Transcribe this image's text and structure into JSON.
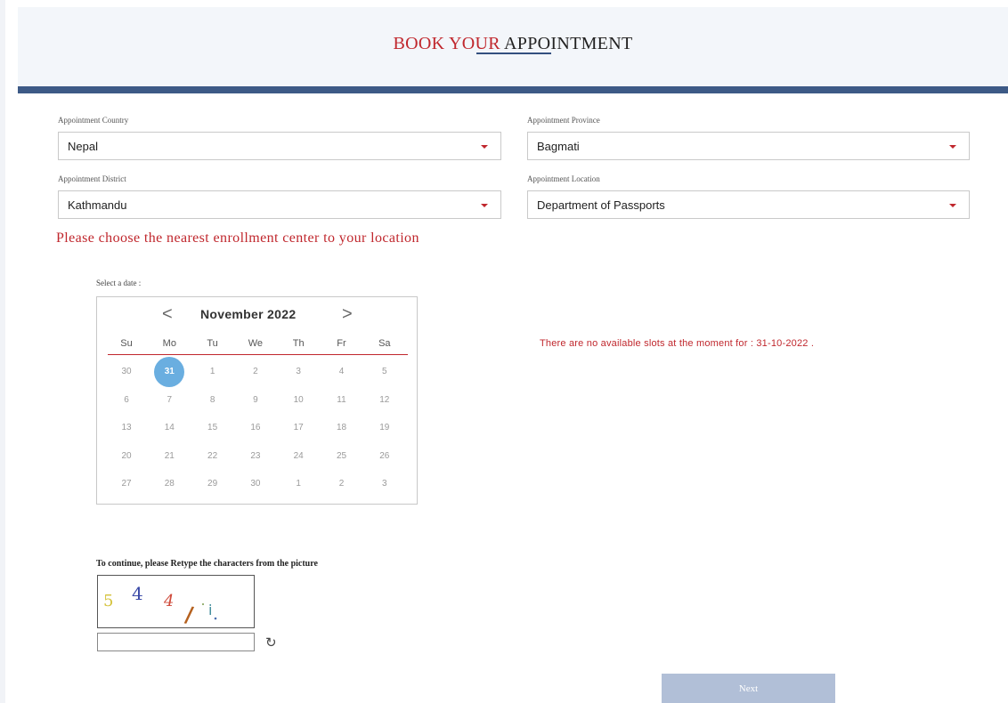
{
  "header": {
    "title_red": "BOOK YOUR",
    "title_dark": "APPOINTMENT"
  },
  "form": {
    "country": {
      "label": "Appointment Country",
      "value": "Nepal"
    },
    "province": {
      "label": "Appointment Province",
      "value": "Bagmati"
    },
    "district": {
      "label": "Appointment District",
      "value": "Kathmandu"
    },
    "location": {
      "label": "Appointment Location",
      "value": "Department of Passports"
    }
  },
  "notice": "Please choose the nearest enrollment center to your location",
  "calendar": {
    "label": "Select a date :",
    "prev": "<",
    "next": ">",
    "month": "November 2022",
    "weekdays": [
      "Su",
      "Mo",
      "Tu",
      "We",
      "Th",
      "Fr",
      "Sa"
    ],
    "weeks": [
      [
        "30",
        "31",
        "1",
        "2",
        "3",
        "4",
        "5"
      ],
      [
        "6",
        "7",
        "8",
        "9",
        "10",
        "11",
        "12"
      ],
      [
        "13",
        "14",
        "15",
        "16",
        "17",
        "18",
        "19"
      ],
      [
        "20",
        "21",
        "22",
        "23",
        "24",
        "25",
        "26"
      ],
      [
        "27",
        "28",
        "29",
        "30",
        "1",
        "2",
        "3"
      ]
    ],
    "selected": "31"
  },
  "slots_message": "There are no available slots at the moment for : 31-10-2022 .",
  "captcha": {
    "label": "To continue, please Retype the characters from the picture",
    "input_value": "",
    "refresh_icon": "refresh-icon",
    "image_chars": [
      "5",
      "4",
      "4",
      "/",
      "i"
    ]
  },
  "next_button": "Next",
  "colors": {
    "accent_red": "#c0272d",
    "header_bar": "#3d5a86",
    "selected_day": "#6aaee0",
    "button": "#b1bfd7"
  }
}
